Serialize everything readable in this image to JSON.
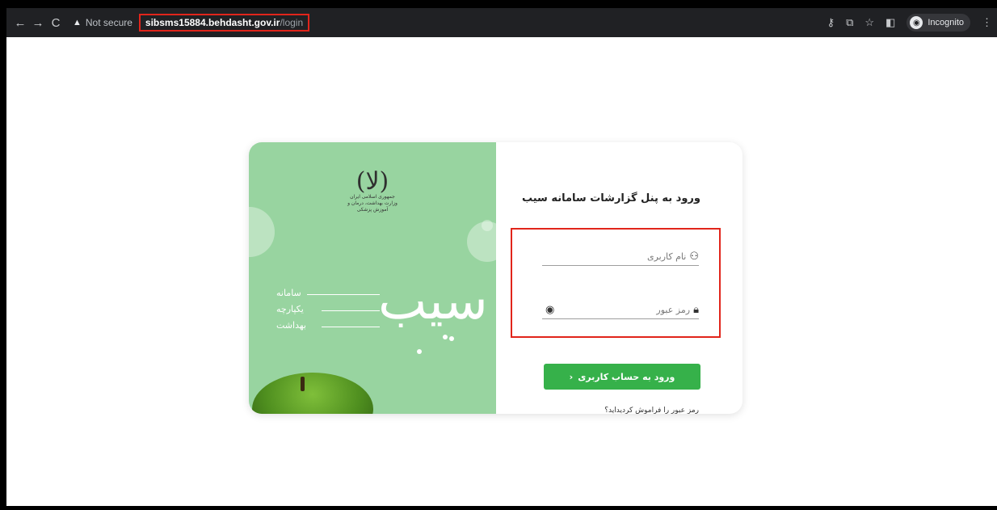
{
  "browser": {
    "not_secure_label": "Not secure",
    "url_domain": "sibsms15884.behdasht.gov.ir",
    "url_path": "/login",
    "incognito_label": "Incognito",
    "icons": [
      "back-arrow-icon",
      "forward-arrow-icon",
      "reload-icon",
      "warning-icon",
      "key-icon",
      "translate-icon",
      "star-icon",
      "side-panel-icon",
      "incognito-icon",
      "kebab-menu-icon"
    ]
  },
  "brand": {
    "emblem_glyph": "(لا)",
    "emblem_line1": "جمهوری اسلامی ایران",
    "emblem_line2": "وزارت بهداشت، درمان و آموزش پزشکی",
    "line1": "سامانه",
    "line2": "یکپارچه",
    "line3": "بهداشت",
    "logo_word": "سیب"
  },
  "login": {
    "title": "ورود به پنل گزارشات سامانه سیب",
    "username_placeholder": "نام کاربری",
    "password_placeholder": "رمز عبور",
    "submit_label": "ورود به حساب کاربری",
    "submit_arrow": "‹",
    "forgot_label": "رمز عبور را فراموش کردید‌اید؟"
  },
  "colors": {
    "accent_green": "#36b14a",
    "panel_green": "#98d4a0",
    "highlight_red": "#e1251b"
  }
}
